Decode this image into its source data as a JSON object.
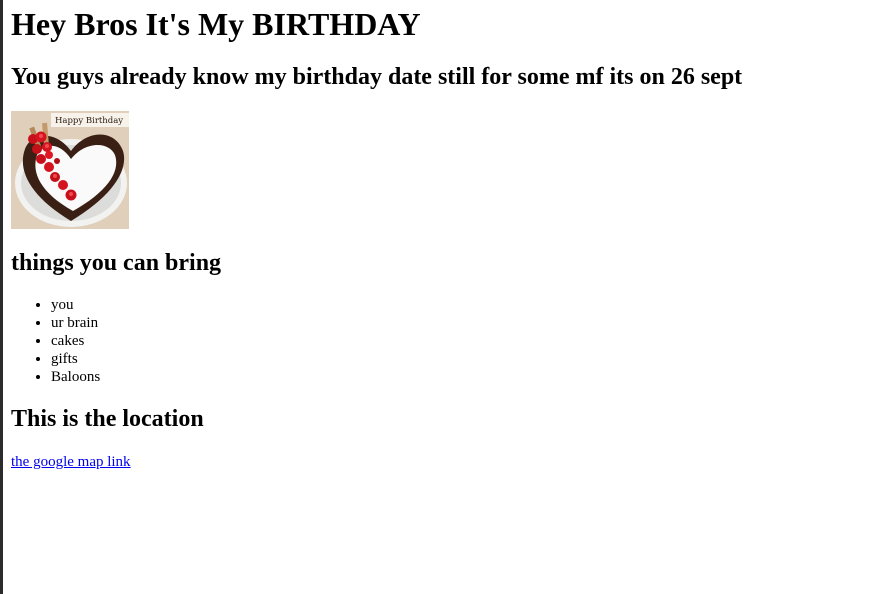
{
  "header": {
    "title": "Hey Bros It's My BIRTHDAY",
    "subtitle": "You guys already know my birthday date still for some mf its on 26 sept"
  },
  "image": {
    "banner_text": "Happy Birthday",
    "icon": "heart-cake-icon"
  },
  "bring": {
    "heading": "things you can bring",
    "items": [
      "you",
      "ur brain",
      "cakes",
      "gifts",
      "Baloons"
    ]
  },
  "location": {
    "heading": "This is the location",
    "link_text": "the google map link"
  },
  "colors": {
    "link": "#0000ee",
    "text": "#000000",
    "edge": "#2b2b2b"
  }
}
